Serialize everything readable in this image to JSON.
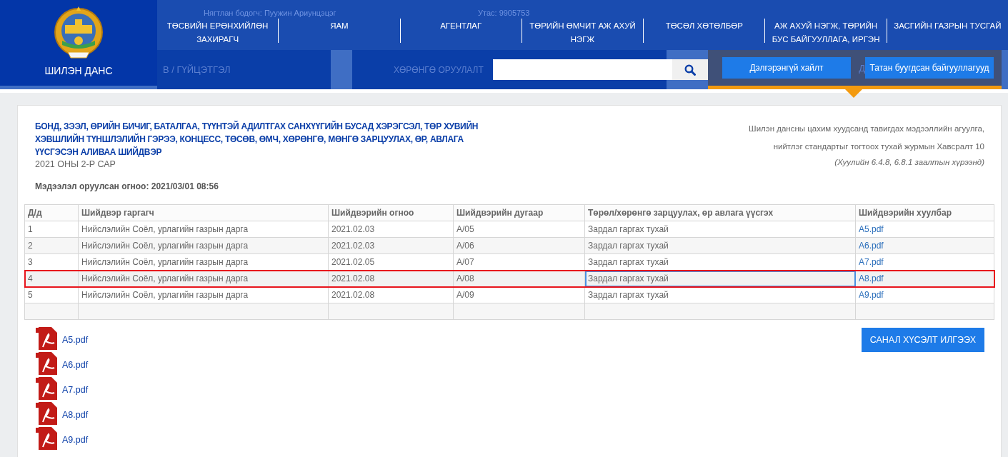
{
  "header": {
    "logo_text": "ШИЛЭН ДАНС",
    "background_texts": [
      "Нягтлан бодогч: Пуужин Ариунцэцэг",
      "Утас: 9905753"
    ],
    "nav": [
      "ТӨСВИЙН ЕРӨНХИЙЛӨН ЗАХИРАГЧ",
      "ЯАМ",
      "АГЕНТЛАГ",
      "ТӨРИЙН ӨМЧИТ АЖ АХУЙ НЭГЖ",
      "ТӨСӨЛ ХӨТӨЛБӨР",
      "АЖ АХУЙ НЭГЖ, ТӨРИЙН БУС БАЙГУУЛЛАГА, ИРГЭН",
      "ЗАСГИЙН ГАЗРЫН ТУСГАЙ"
    ],
    "tabs": [
      {
        "label": "В / ГҮЙЦЭТГЭЛ",
        "selected": false
      },
      {
        "label": "ХӨРӨНГӨ ОРУУЛАЛТ",
        "selected": false
      },
      {
        "label": "Д",
        "selected": true
      }
    ],
    "buttons": [
      "Дэлгэрэнгүй хайлт",
      "Татан буугдсан байгууллагууд"
    ]
  },
  "document": {
    "title": "БОНД, ЗЭЭЛ, ӨРИЙН БИЧИГ, БАТАЛГАА, ТҮҮНТЭЙ АДИЛТГАХ САНХҮҮГИЙН БУСАД ХЭРЭГСЭЛ, ТӨР ХУВИЙН ХЭВШЛИЙН ТҮНШЛЭЛИЙН ГЭРЭЭ, КОНЦЕСС, ТӨСӨВ, ӨМЧ, ХӨРӨНГӨ, МӨНГӨ ЗАРЦУУЛАХ, ӨР, АВЛАГА ҮҮСГЭСЭН АЛИВАА ШИЙДВЭР",
    "period": "2021 ОНЫ 2-Р САР",
    "posted": "Мэдээлэл оруулсан огноо: 2021/03/01 08:56",
    "regulation": [
      "Шилэн дансны цахим хуудсанд тавигдах мэдээллийн агуулга,",
      "нийтлэг стандартыг тогтоох тухай журмын Хавсралт 10"
    ],
    "regulation_note": "(Хуулийн 6.4.8, 6.8.1 заалтын хүрээнд)"
  },
  "table": {
    "columns": [
      "Д/д",
      "Шийдвэр гаргагч",
      "Шийдвэрийн огноо",
      "Шийдвэрийн дугаар",
      "Төрөл/хөрөнгө зарцуулах, өр авлага үүсгэх",
      "Шийдвэрийн хуулбар"
    ],
    "rows": [
      {
        "cells": [
          "1",
          "Нийслэлийн Соёл, урлагийн газрын дарга",
          "2021.02.03",
          "А/05",
          "Зардал гаргах тухай",
          "A5.pdf"
        ],
        "selected": false
      },
      {
        "cells": [
          "2",
          "Нийслэлийн Соёл, урлагийн газрын дарга",
          "2021.02.03",
          "А/06",
          "Зардал гаргах тухай",
          "A6.pdf"
        ],
        "selected": false
      },
      {
        "cells": [
          "3",
          "Нийслэлийн Соёл, урлагийн газрын дарга",
          "2021.02.05",
          "А/07",
          "Зардал гаргах тухай",
          "A7.pdf"
        ],
        "selected": false
      },
      {
        "cells": [
          "4",
          "Нийслэлийн Соёл, урлагийн газрын дарга",
          "2021.02.08",
          "А/08",
          "Зардал гаргах тухай",
          "A8.pdf"
        ],
        "selected": true
      },
      {
        "cells": [
          "5",
          "Нийслэлийн Соёл, урлагийн газрын дарга",
          "2021.02.08",
          "А/09",
          "Зардал гаргах тухай",
          "A9.pdf"
        ],
        "selected": false
      }
    ]
  },
  "attachments": [
    "A5.pdf",
    "A6.pdf",
    "A7.pdf",
    "A8.pdf",
    "A9.pdf"
  ],
  "feedback_button": "САНАЛ ХҮСЭЛТ ИЛГЭЭХ"
}
